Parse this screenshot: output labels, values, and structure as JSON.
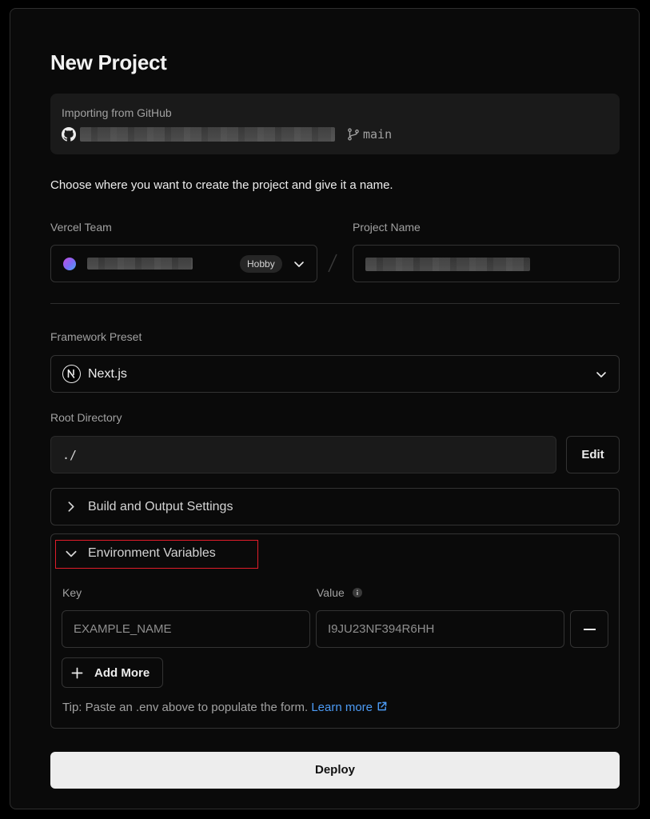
{
  "page": {
    "title": "New Project"
  },
  "import": {
    "label": "Importing from GitHub",
    "repo_icon": "github-icon",
    "branch_icon": "git-branch-icon",
    "branch": "main"
  },
  "instruction": "Choose where you want to create the project and give it a name.",
  "team": {
    "label": "Vercel Team",
    "plan_badge": "Hobby",
    "chevron_icon": "chevron-down-icon"
  },
  "project": {
    "label": "Project Name"
  },
  "framework": {
    "label": "Framework Preset",
    "value": "Next.js",
    "logo_icon": "nextjs-logo-icon"
  },
  "root": {
    "label": "Root Directory",
    "value": "./",
    "edit_label": "Edit"
  },
  "build": {
    "title": "Build and Output Settings",
    "expanded": false
  },
  "env": {
    "title": "Environment Variables",
    "expanded": true,
    "key_label": "Key",
    "value_label": "Value",
    "key_placeholder": "EXAMPLE_NAME",
    "value_placeholder": "I9JU23NF394R6HH",
    "add_more_label": "Add More",
    "tip_text": "Tip: Paste an .env above to populate the form.",
    "learn_more": "Learn more"
  },
  "deploy": {
    "label": "Deploy"
  },
  "colors": {
    "background": "#0a0a0a",
    "border": "#333333",
    "link": "#4c9bf5",
    "highlight": "#e11d2a",
    "deploy_bg": "#ededed"
  }
}
